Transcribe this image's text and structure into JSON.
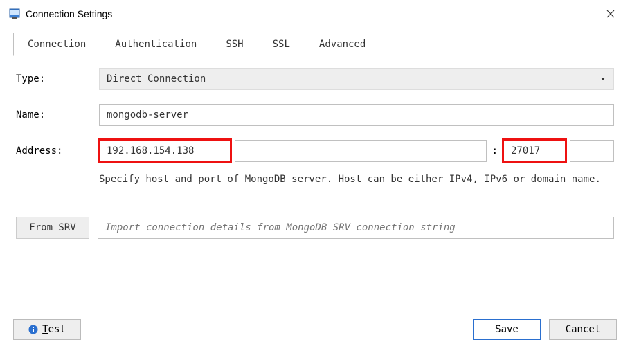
{
  "window": {
    "title": "Connection Settings"
  },
  "tabs": {
    "connection": "Connection",
    "authentication": "Authentication",
    "ssh": "SSH",
    "ssl": "SSL",
    "advanced": "Advanced"
  },
  "labels": {
    "type": "Type:",
    "name": "Name:",
    "address": "Address:",
    "colon": ":"
  },
  "form": {
    "type_value": "Direct Connection",
    "name_value": "mongodb-server",
    "host_value": "192.168.154.138",
    "port_value": "27017",
    "hint": "Specify host and port of MongoDB server. Host can be either IPv4, IPv6 or domain name.",
    "from_srv_label": "From SRV",
    "srv_placeholder": "Import connection details from MongoDB SRV connection string"
  },
  "buttons": {
    "test": "Test",
    "save": "Save",
    "cancel": "Cancel"
  }
}
